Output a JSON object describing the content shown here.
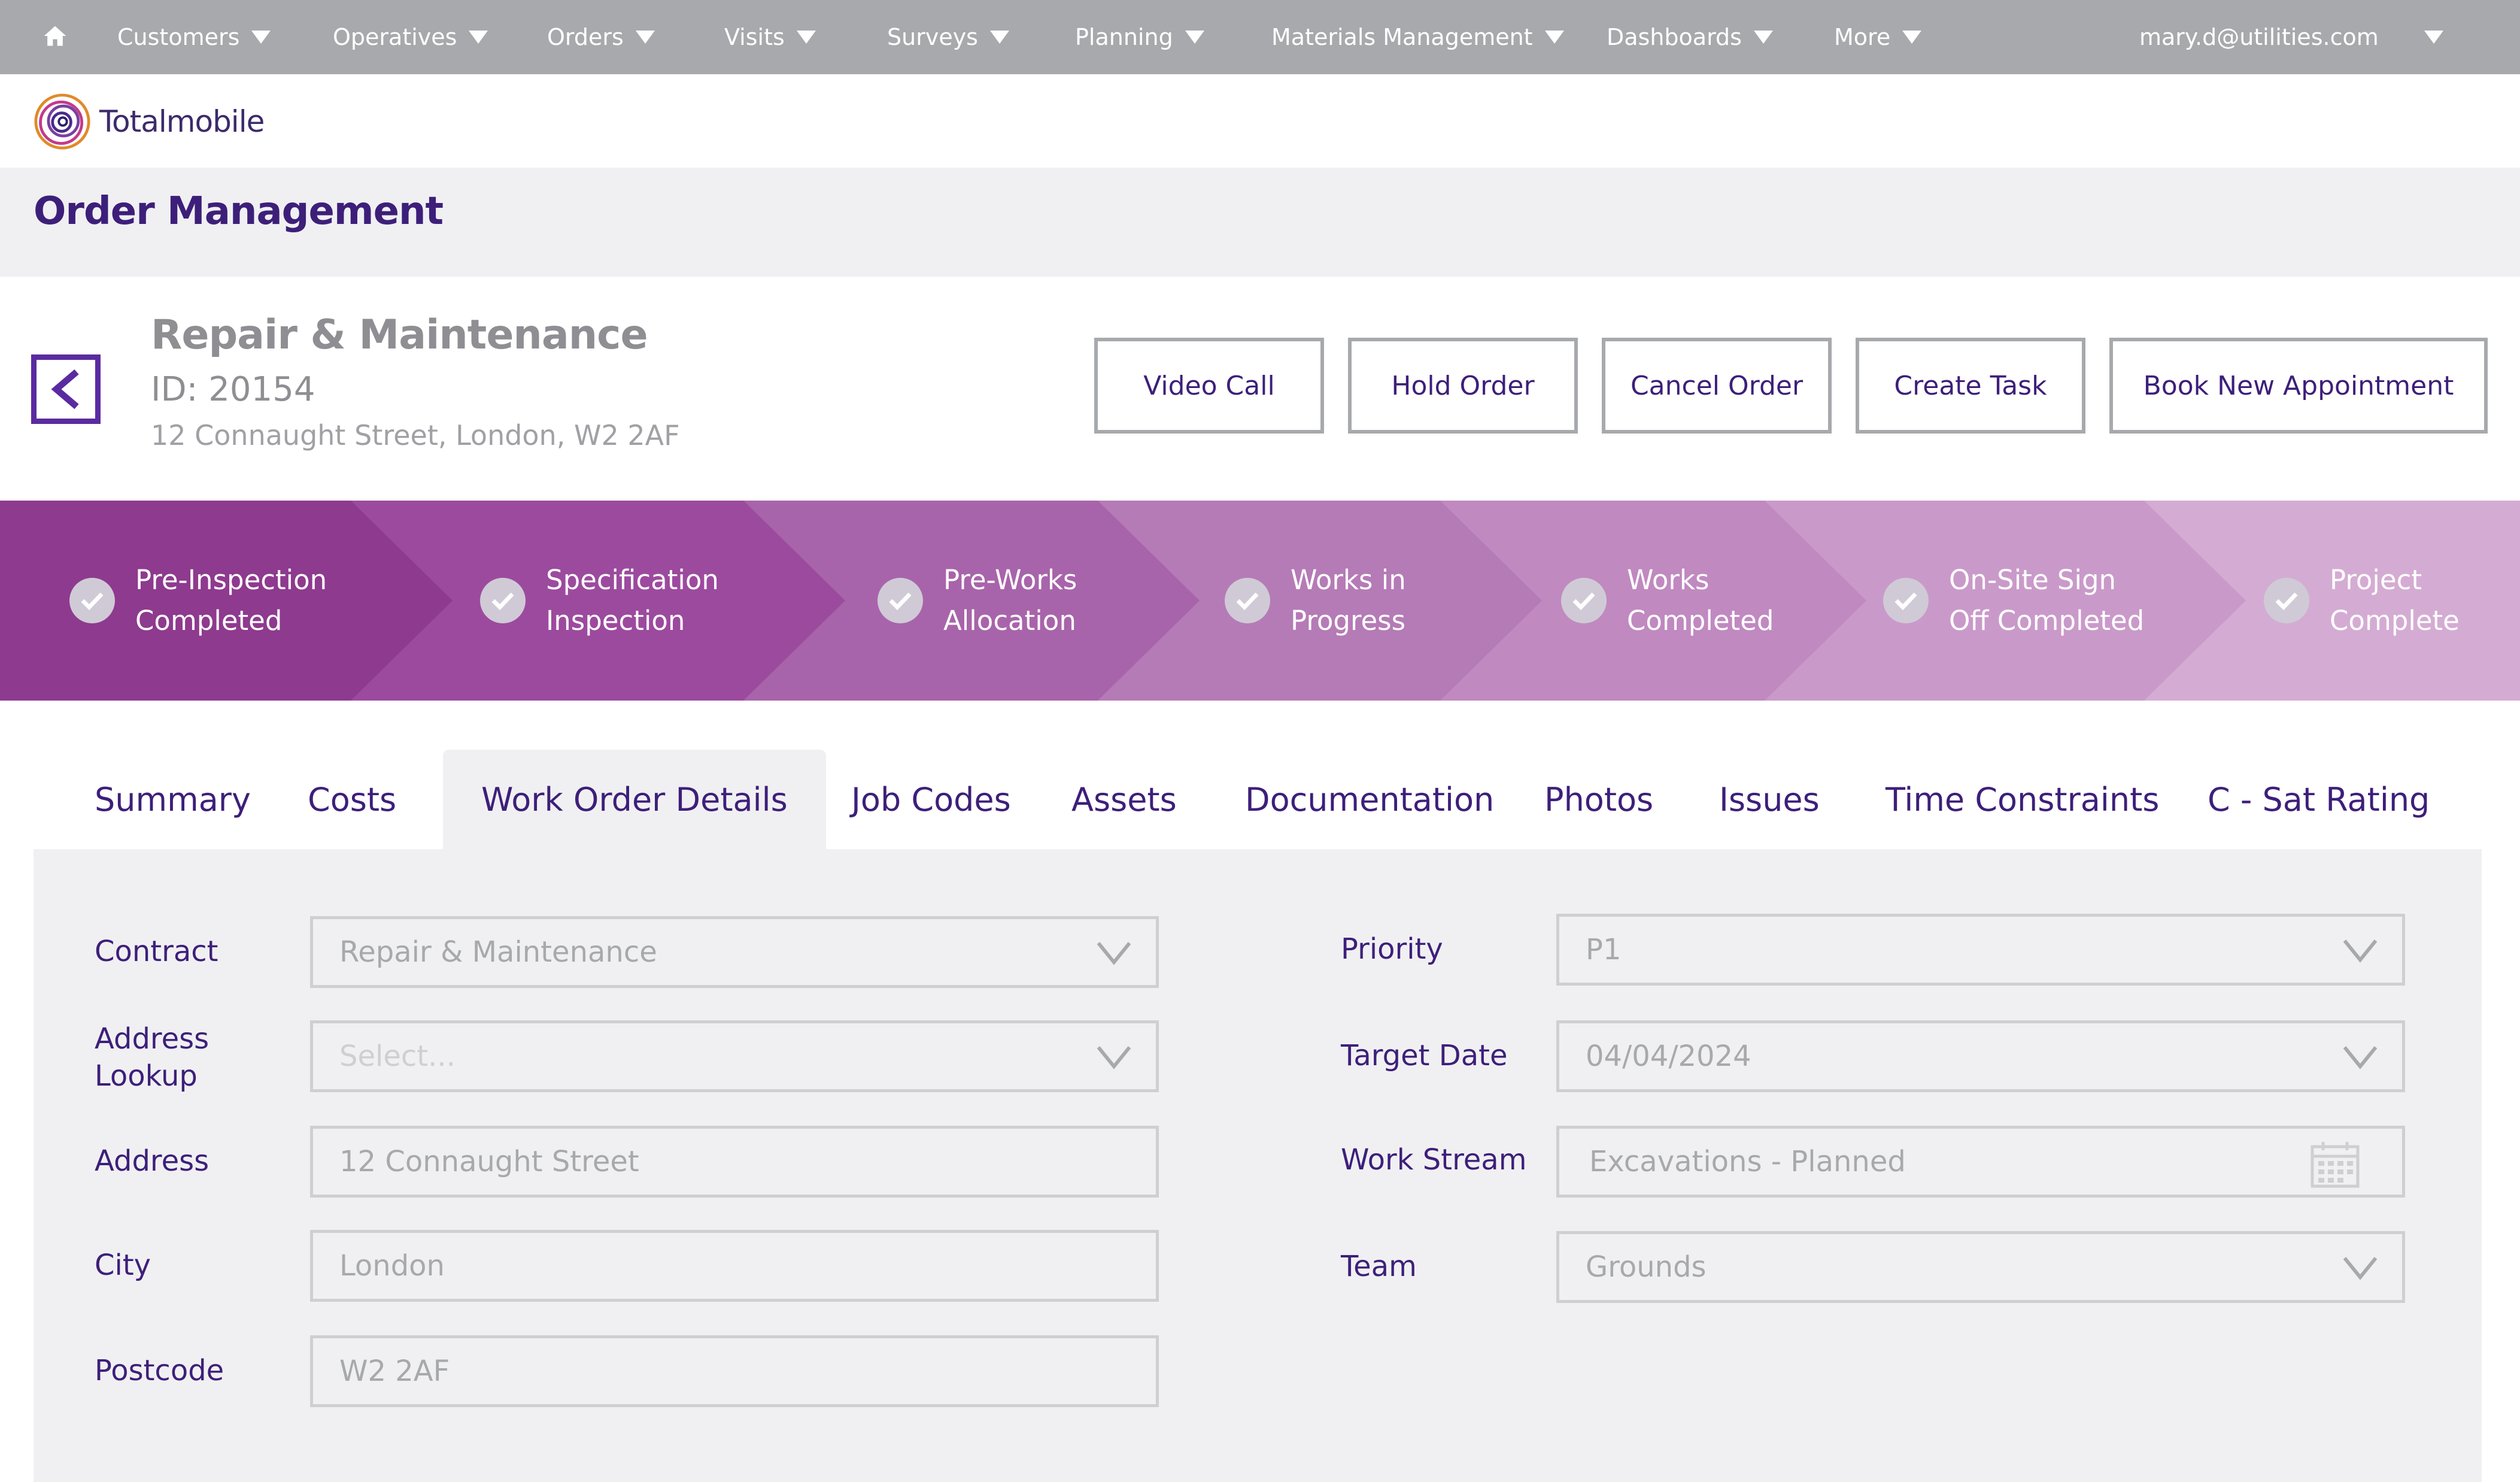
{
  "nav": {
    "items": [
      {
        "label": "Customers"
      },
      {
        "label": "Operatives"
      },
      {
        "label": "Orders"
      },
      {
        "label": "Visits"
      },
      {
        "label": "Surveys"
      },
      {
        "label": "Planning"
      },
      {
        "label": "Materials Management"
      },
      {
        "label": "Dashboards"
      },
      {
        "label": "More"
      }
    ],
    "user_email": "mary.d@utilities.com"
  },
  "logo": {
    "text": "Totalmobile"
  },
  "page": {
    "title": "Order Management"
  },
  "order": {
    "type": "Repair & Maintenance",
    "id": "ID: 20154",
    "address": "12 Connaught Street, London, W2 2AF"
  },
  "actions": {
    "video_call": "Video Call",
    "hold_order": "Hold Order",
    "cancel_order": "Cancel Order",
    "create_task": "Create Task",
    "book_appointment": "Book New Appointment"
  },
  "progress": {
    "stages": [
      {
        "label": "Pre-Inspection\nCompleted",
        "color": "#8e3a8e"
      },
      {
        "label": "Specification\nInspection",
        "color": "#9c4a9e"
      },
      {
        "label": "Pre-Works\nAllocation",
        "color": "#a864aa"
      },
      {
        "label": "Works in\nProgress",
        "color": "#b57bb6"
      },
      {
        "label": "Works\nCompleted",
        "color": "#c089c0"
      },
      {
        "label": "On-Site Sign\nOff Completed",
        "color": "#c99ac9"
      },
      {
        "label": "Project\nComplete",
        "color": "#d4acd3"
      }
    ]
  },
  "tabs": [
    {
      "label": "Summary"
    },
    {
      "label": "Costs"
    },
    {
      "label": "Work Order Details"
    },
    {
      "label": "Job Codes"
    },
    {
      "label": "Assets"
    },
    {
      "label": "Documentation"
    },
    {
      "label": "Photos"
    },
    {
      "label": "Issues"
    },
    {
      "label": "Time Constraints"
    },
    {
      "label": "C - Sat Rating"
    }
  ],
  "active_tab": "Work Order Details",
  "form": {
    "contract": {
      "label": "Contract",
      "value": "Repair & Maintenance"
    },
    "address_lookup": {
      "label": "Address\nLookup",
      "placeholder": "Select..."
    },
    "address": {
      "label": "Address",
      "value": "12 Connaught Street"
    },
    "city": {
      "label": "City",
      "value": "London"
    },
    "postcode": {
      "label": "Postcode",
      "value": "W2 2AF"
    },
    "priority": {
      "label": "Priority",
      "value": "P1"
    },
    "target_date": {
      "label": "Target Date",
      "value": "04/04/2024"
    },
    "work_stream": {
      "label": "Work Stream",
      "value": "Excavations - Planned"
    },
    "team": {
      "label": "Team",
      "value": "Grounds"
    }
  },
  "colors": {
    "nav_bg": "#a7a9ac",
    "brand_purple": "#3d1f7a",
    "panel_bg": "#f0f0f2"
  },
  "icons": {
    "home": "home-icon",
    "dropdown": "caret-down-icon",
    "back": "chevron-left-icon",
    "check": "check-circle-icon",
    "select": "chevron-down-icon",
    "calendar": "calendar-icon"
  }
}
